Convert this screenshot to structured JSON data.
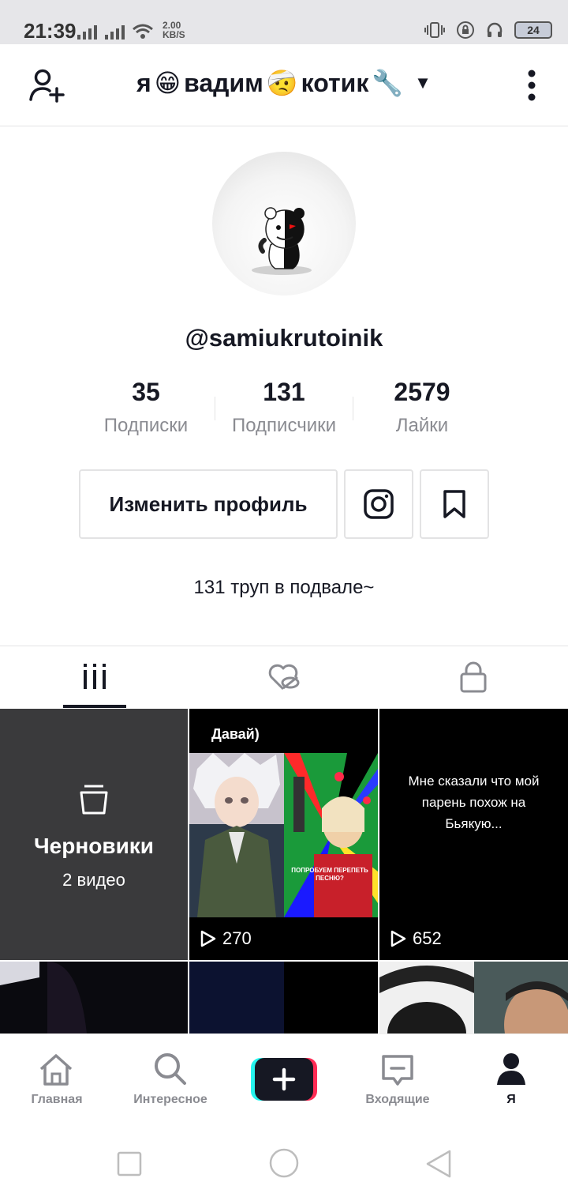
{
  "status_bar": {
    "time": "21:39",
    "speed_value": "2.00",
    "speed_unit": "KB/S",
    "battery": "24"
  },
  "header": {
    "title_parts": [
      "я",
      "😁",
      "вадим",
      "🤕",
      "котик",
      "🔧"
    ]
  },
  "profile": {
    "username": "@samiukrutoinik",
    "stats": [
      {
        "value": "35",
        "label": "Подписки"
      },
      {
        "value": "131",
        "label": "Подписчики"
      },
      {
        "value": "2579",
        "label": "Лайки"
      }
    ],
    "edit_button": "Изменить профиль",
    "bio": "131 труп в подвале~"
  },
  "tabs": [
    "videos-icon",
    "liked-hidden-icon",
    "lock-icon"
  ],
  "grid": {
    "drafts_title": "Черновики",
    "drafts_count": "2 видео",
    "video1_caption": "Давай)",
    "video1_sticker": "ПОПРОБУЕМ ПЕРЕПЕТЬ ПЕСНЮ?",
    "video1_views": "270",
    "video2_caption": "Мне сказали что мой парень похож на Бьякую...",
    "video2_views": "652"
  },
  "bottom_nav": [
    {
      "label": "Главная",
      "icon": "home-icon"
    },
    {
      "label": "Интересное",
      "icon": "search-icon"
    },
    {
      "label": "",
      "icon": "plus-icon"
    },
    {
      "label": "Входящие",
      "icon": "inbox-icon"
    },
    {
      "label": "Я",
      "icon": "profile-icon"
    }
  ],
  "colors": {
    "primary_text": "#161823",
    "secondary_text": "#8a8b91",
    "border": "#e3e3e4",
    "plus_cyan": "#25f4ee",
    "plus_red": "#fe2c55"
  }
}
